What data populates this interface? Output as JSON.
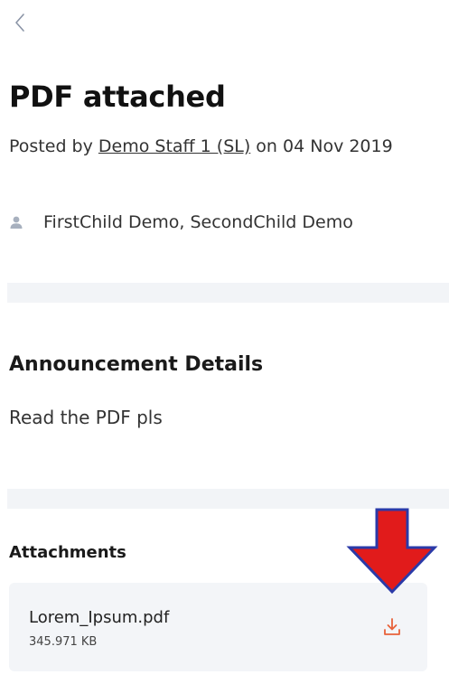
{
  "header": {
    "back_icon": "chevron-left-icon"
  },
  "announcement": {
    "title": "PDF attached",
    "posted_prefix": "Posted by ",
    "author": "Demo Staff 1 (SL)",
    "posted_date_text": " on 04 Nov 2019",
    "recipients_icon": "person-icon",
    "recipients": "FirstChild Demo, SecondChild Demo"
  },
  "details": {
    "heading": "Announcement Details",
    "body": "Read the PDF pls"
  },
  "attachments": {
    "heading": "Attachments",
    "items": [
      {
        "file_name": "Lorem_Ipsum.pdf",
        "file_size": "345.971 KB",
        "action_icon": "download-icon"
      }
    ]
  },
  "colors": {
    "accent": "#e8623a",
    "arrow_fill": "#e11b1b",
    "arrow_stroke": "#2b3aa8",
    "divider": "#f2f4f7",
    "card": "#f3f5f8"
  }
}
